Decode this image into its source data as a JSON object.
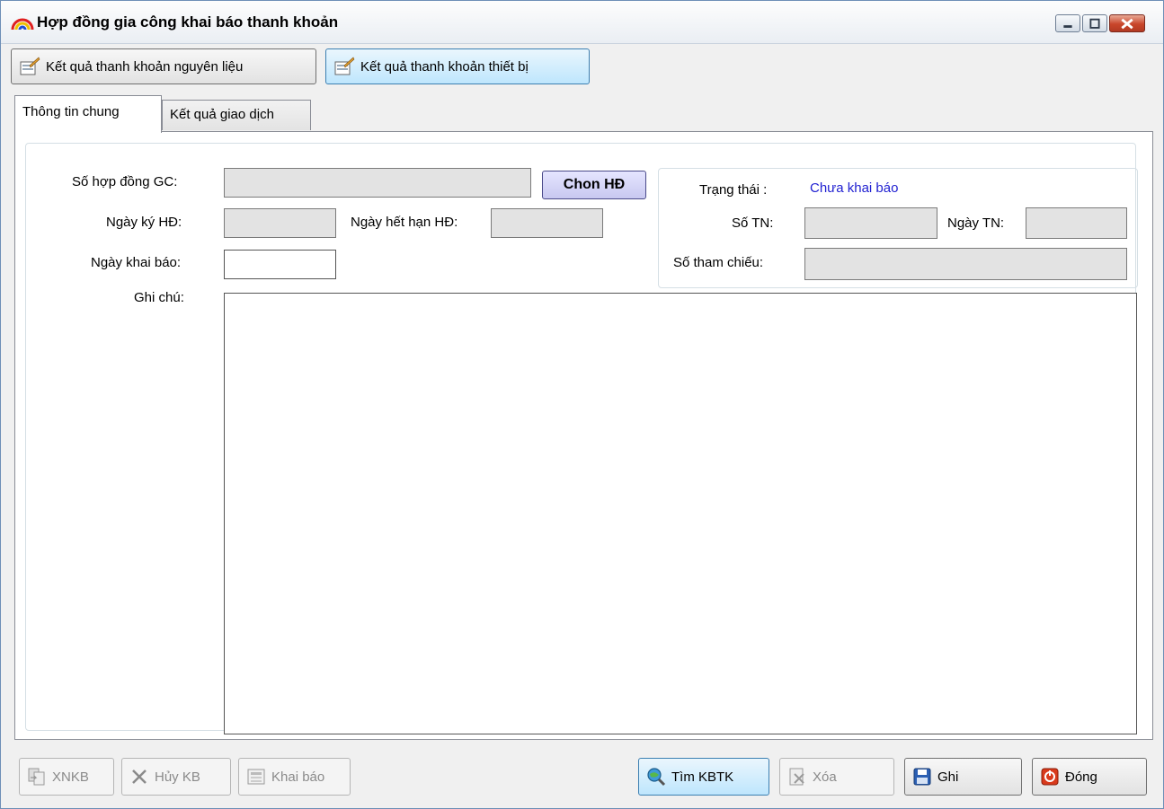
{
  "window": {
    "title": "Hợp đồng gia công khai báo thanh khoản",
    "icon": "rainbow-arc-icon"
  },
  "toolbar": {
    "btn_nguyen_lieu": "Kết quả thanh khoản nguyên liệu",
    "btn_thiet_bi": "Kết quả thanh khoản thiết bị"
  },
  "tabs": {
    "general": "Thông tin chung",
    "results": "Kết quả giao dịch"
  },
  "form": {
    "so_hop_dong_label": "Số hợp đồng GC:",
    "so_hop_dong_value": "",
    "chon_hd_label": "Chon HĐ",
    "ngay_ky_label": "Ngày ký HĐ:",
    "ngay_ky_value": "",
    "ngay_het_han_label": "Ngày hết hạn HĐ:",
    "ngay_het_han_value": "",
    "ngay_khai_bao_label": "Ngày khai báo:",
    "ngay_khai_bao_value": "",
    "ghi_chu_label": "Ghi chú:",
    "ghi_chu_value": ""
  },
  "status": {
    "trang_thai_label": "Trạng thái :",
    "trang_thai_value": "Chưa khai báo",
    "so_tn_label": "Số TN:",
    "so_tn_value": "",
    "ngay_tn_label": "Ngày TN:",
    "ngay_tn_value": "",
    "so_tham_chieu_label": "Số tham chiếu:",
    "so_tham_chieu_value": ""
  },
  "footer": {
    "xnkb": "XNKB",
    "huy_kb": "Hủy KB",
    "khai_bao": "Khai báo",
    "tim_kbtk": "Tìm KBTK",
    "xoa": "Xóa",
    "ghi": "Ghi",
    "dong": "Đóng"
  },
  "colors": {
    "status_value": "#1f1fd1",
    "title_bar": "#eaeef3",
    "close_button": "#c9462b"
  }
}
